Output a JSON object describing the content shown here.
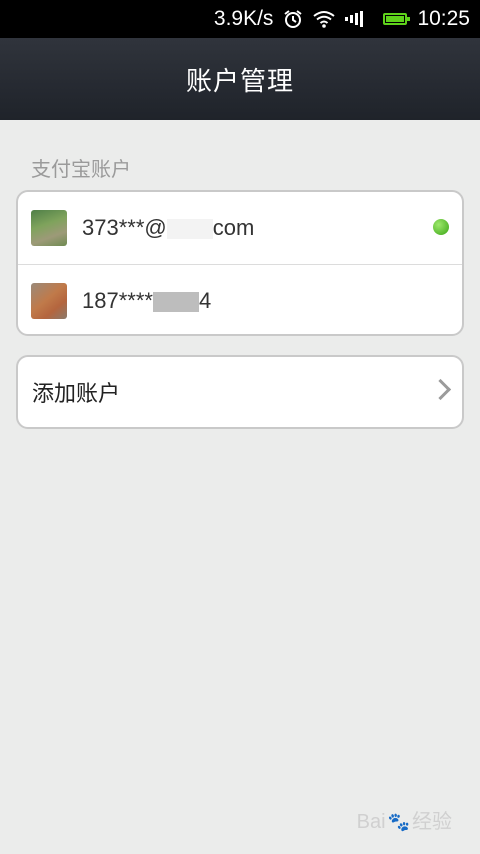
{
  "status_bar": {
    "speed": "3.9K/s",
    "time": "10:25",
    "icons": [
      "alarm-icon",
      "wifi-icon",
      "signal-icon",
      "battery-icon"
    ],
    "battery_color": "#5fd31b"
  },
  "header": {
    "title": "账户管理"
  },
  "section": {
    "label": "支付宝账户"
  },
  "accounts": [
    {
      "text": "373***@",
      "suffix": "com",
      "online": true
    },
    {
      "text": "187****",
      "suffix": "4",
      "online": false
    }
  ],
  "add_account": {
    "label": "添加账户"
  },
  "watermark": {
    "brand": "Bai",
    "brand2": "经验"
  },
  "colors": {
    "online_dot": "#3aa516",
    "header_bg": "#262a31",
    "page_bg": "#ebeceb"
  }
}
